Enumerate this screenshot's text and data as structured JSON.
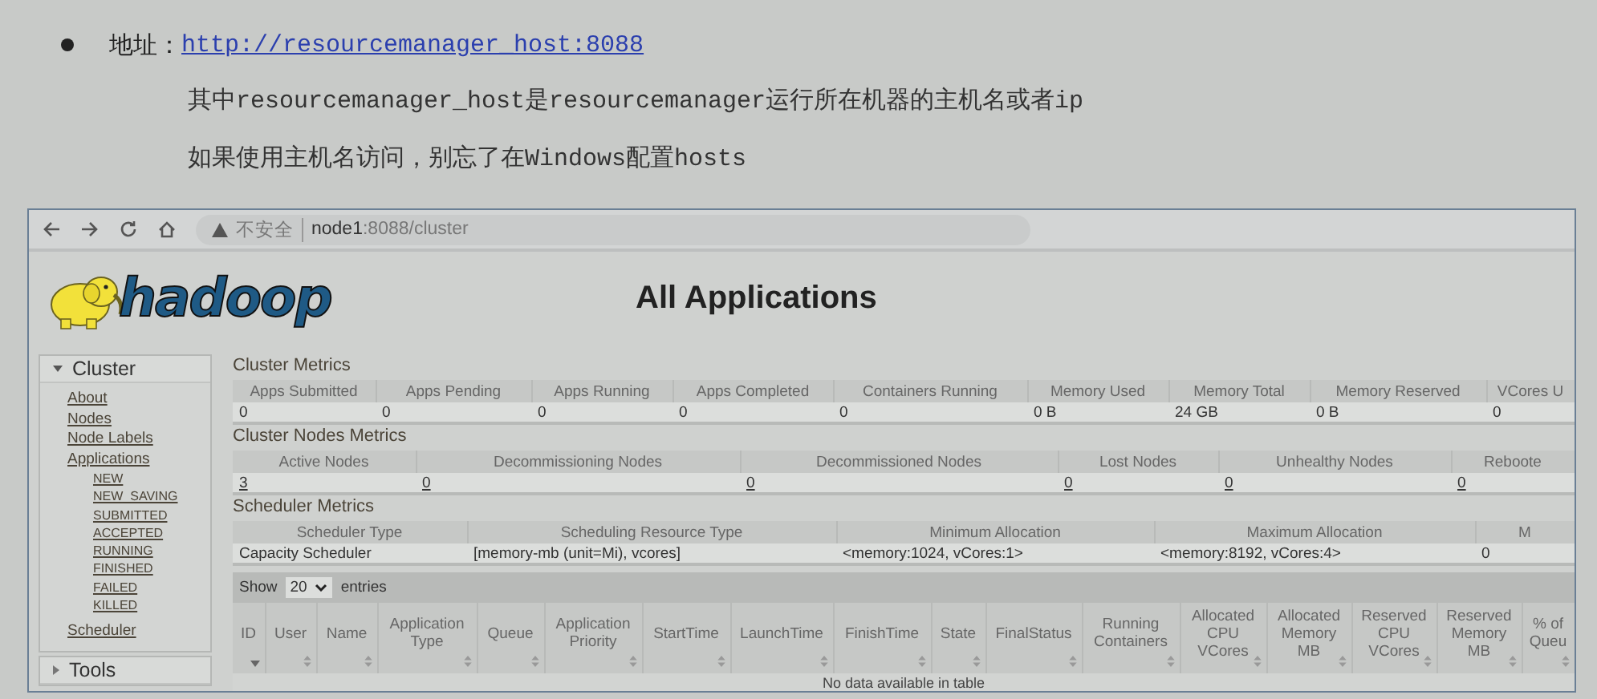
{
  "slide": {
    "address_label": "地址：",
    "address_link": "http://resourcemanager_host:8088",
    "notes": [
      "其中resourcemanager_host是resourcemanager运行所在机器的主机名或者ip",
      "如果使用主机名访问，别忘了在Windows配置hosts"
    ]
  },
  "browser": {
    "security_label": "不安全",
    "url": "**node1**:8088/cluster"
  },
  "logo_text": "hadoop",
  "page_title": "All Applications",
  "sidebar": [
    {
      "label": "Cluster",
      "expanded": true,
      "items": [
        {
          "label": "About"
        },
        {
          "label": "Nodes"
        },
        {
          "label": "Node Labels"
        },
        {
          "label": "Applications",
          "children": [
            {
              "label": "NEW"
            },
            {
              "label": "NEW_SAVING"
            },
            {
              "label": "SUBMITTED"
            },
            {
              "label": "ACCEPTED"
            },
            {
              "label": "RUNNING"
            },
            {
              "label": "FINISHED"
            },
            {
              "label": "FAILED"
            },
            {
              "label": "KILLED"
            }
          ]
        },
        {
          "label": "Scheduler"
        }
      ]
    },
    {
      "label": "Tools",
      "expanded": false
    }
  ],
  "metrics": [
    {
      "title": "Cluster Metrics",
      "values_linked": false,
      "columns": [
        "Apps Submitted",
        "Apps Pending",
        "Apps Running",
        "Apps Completed",
        "Containers Running",
        "Memory Used",
        "Memory Total",
        "Memory Reserved",
        "VCores U"
      ],
      "values": [
        "0",
        "0",
        "0",
        "0",
        "0",
        "0 B",
        "24 GB",
        "0 B",
        "0"
      ]
    },
    {
      "title": "Cluster Nodes Metrics",
      "values_linked": true,
      "columns": [
        "Active Nodes",
        "Decommissioning Nodes",
        "Decommissioned Nodes",
        "Lost Nodes",
        "Unhealthy Nodes",
        "Reboote"
      ],
      "values": [
        "3",
        "0",
        "0",
        "0",
        "0",
        "0"
      ]
    },
    {
      "title": "Scheduler Metrics",
      "values_linked": false,
      "columns": [
        "Scheduler Type",
        "Scheduling Resource Type",
        "Minimum Allocation",
        "Maximum Allocation",
        "M"
      ],
      "values": [
        "Capacity Scheduler",
        "[memory-mb (unit=Mi), vcores]",
        "<memory:1024, vCores:1>",
        "<memory:8192, vCores:4>",
        "0"
      ]
    }
  ],
  "entries_control": {
    "show_label": "Show",
    "value": "20",
    "entries_label": "entries"
  },
  "applications_table": {
    "columns": [
      {
        "label": "ID",
        "sorted": true
      },
      {
        "label": "User",
        "sorted": false
      },
      {
        "label": "Name",
        "sorted": false
      },
      {
        "label": "Application Type",
        "sorted": false
      },
      {
        "label": "Queue",
        "sorted": false
      },
      {
        "label": "Application Priority",
        "sorted": false
      },
      {
        "label": "StartTime",
        "sorted": false
      },
      {
        "label": "LaunchTime",
        "sorted": false
      },
      {
        "label": "FinishTime",
        "sorted": false
      },
      {
        "label": "State",
        "sorted": false
      },
      {
        "label": "FinalStatus",
        "sorted": false
      },
      {
        "label": "Running Containers",
        "sorted": false
      },
      {
        "label": "Allocated CPU VCores",
        "sorted": false
      },
      {
        "label": "Allocated Memory MB",
        "sorted": false
      },
      {
        "label": "Reserved CPU VCores",
        "sorted": false
      },
      {
        "label": "Reserved Memory MB",
        "sorted": false
      },
      {
        "label": "% of Queu",
        "sorted": false
      }
    ],
    "empty_message": "No data available in table"
  }
}
